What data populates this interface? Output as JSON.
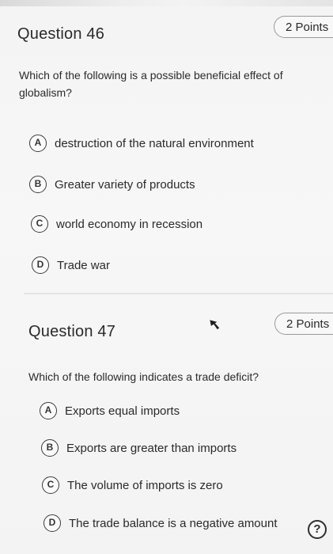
{
  "questions": [
    {
      "title": "Question 46",
      "points": "2 Points",
      "text": "Which of the following is a possible beneficial effect of globalism?",
      "options": [
        {
          "letter": "A",
          "label": "destruction of the natural environment"
        },
        {
          "letter": "B",
          "label": "Greater variety of products"
        },
        {
          "letter": "C",
          "label": "world economy in recession"
        },
        {
          "letter": "D",
          "label": "Trade war"
        }
      ]
    },
    {
      "title": "Question 47",
      "points": "2 Points",
      "text": "Which of the following indicates a trade deficit?",
      "options": [
        {
          "letter": "A",
          "label": "Exports equal imports"
        },
        {
          "letter": "B",
          "label": "Exports are greater than imports"
        },
        {
          "letter": "C",
          "label": "The volume of imports is zero"
        },
        {
          "letter": "D",
          "label": "The trade balance is a negative amount"
        }
      ]
    }
  ],
  "help": {
    "glyph": "?",
    "icon": "help-icon"
  },
  "cursor": {
    "icon": "mouse-pointer-icon"
  }
}
